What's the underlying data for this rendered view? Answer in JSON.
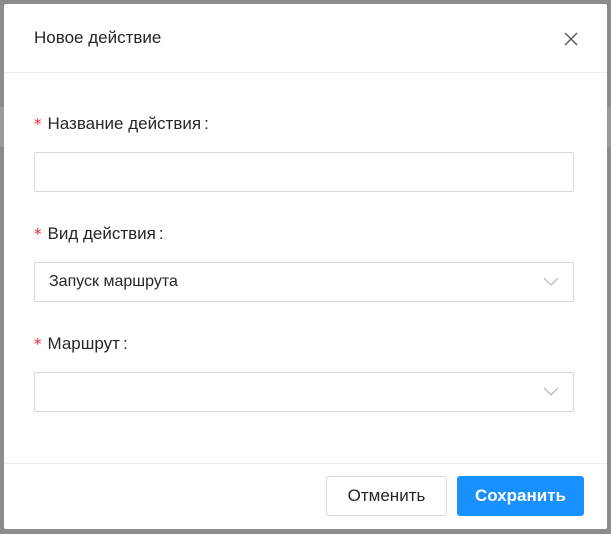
{
  "modal": {
    "title": "Новое действие",
    "close_icon": "close-icon"
  },
  "form": {
    "action_name": {
      "required_mark": "*",
      "label": "Название действия",
      "colon": ":",
      "value": ""
    },
    "action_type": {
      "required_mark": "*",
      "label": "Вид действия",
      "colon": ":",
      "value": "Запуск маршрута",
      "icon": "chevron-down-icon"
    },
    "route": {
      "required_mark": "*",
      "label": "Маршрут",
      "colon": ":",
      "value": "",
      "icon": "chevron-down-icon"
    }
  },
  "footer": {
    "cancel_label": "Отменить",
    "save_label": "Сохранить"
  },
  "colors": {
    "primary": "#1890ff",
    "required": "#f5222d",
    "border": "#d9d9d9",
    "overlay": "#8c8c8c"
  }
}
